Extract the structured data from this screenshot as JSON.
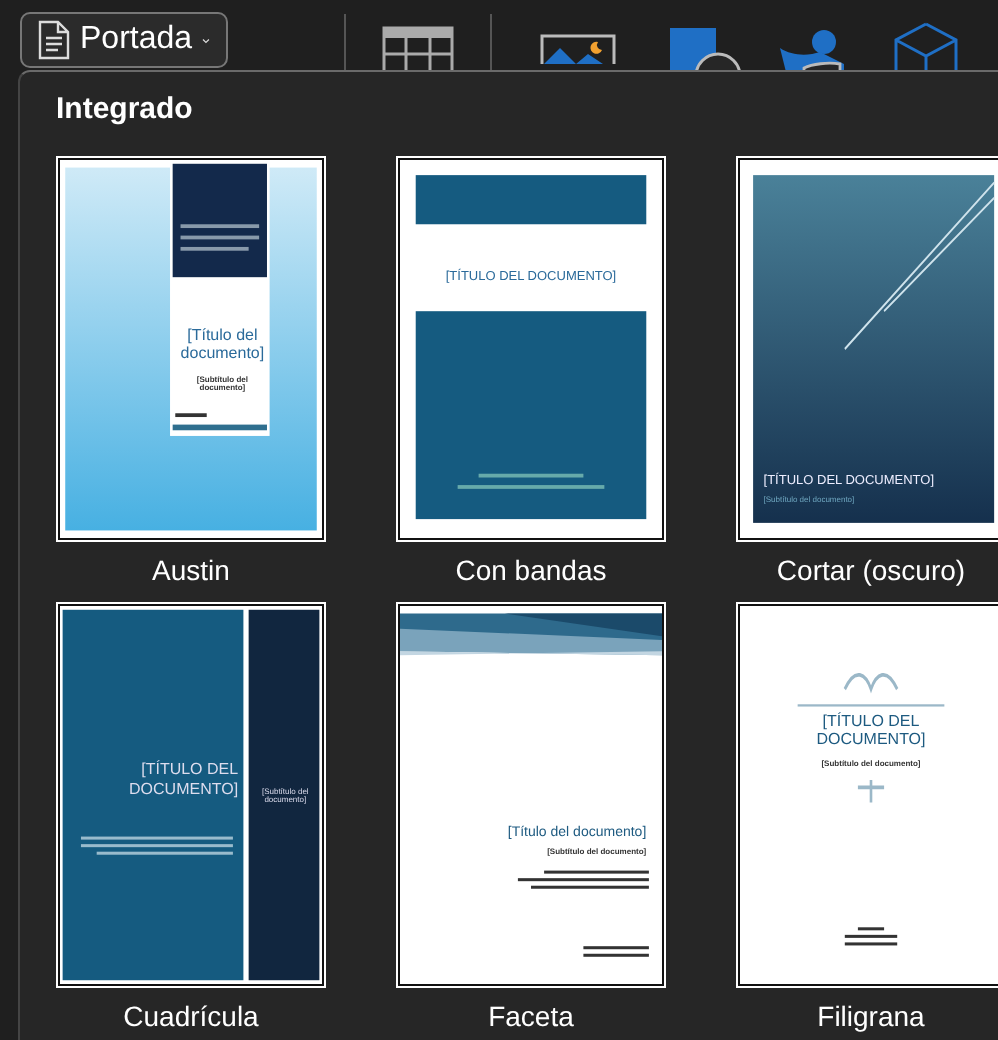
{
  "toolbar": {
    "cover_button": {
      "label": "Portada",
      "expanded": true
    }
  },
  "gallery": {
    "section_title": "Integrado",
    "templates": [
      {
        "name": "Austin",
        "kind": "austin",
        "title": "[Título del documento]",
        "subtitle": "[Subtítulo del documento]"
      },
      {
        "name": "Con bandas",
        "kind": "bands",
        "title": "[TÍTULO DEL DOCUMENTO]"
      },
      {
        "name": "Cortar (oscuro)",
        "kind": "cut",
        "title": "[TÍTULO DEL DOCUMENTO]",
        "subtitle": "[Subtítulo del documento]"
      },
      {
        "name": "Cuadrícula",
        "kind": "grid",
        "title": "[TÍTULO DEL DOCUMENTO]",
        "subtitle": "[Subtítulo del documento]"
      },
      {
        "name": "Faceta",
        "kind": "facet",
        "title": "[Título del documento]",
        "subtitle": "[Subtítulo del documento]"
      },
      {
        "name": "Filigrana",
        "kind": "filigree",
        "title": "[TÍTULO DEL DOCUMENTO]",
        "subtitle": "[Subtítulo del documento]"
      }
    ]
  }
}
